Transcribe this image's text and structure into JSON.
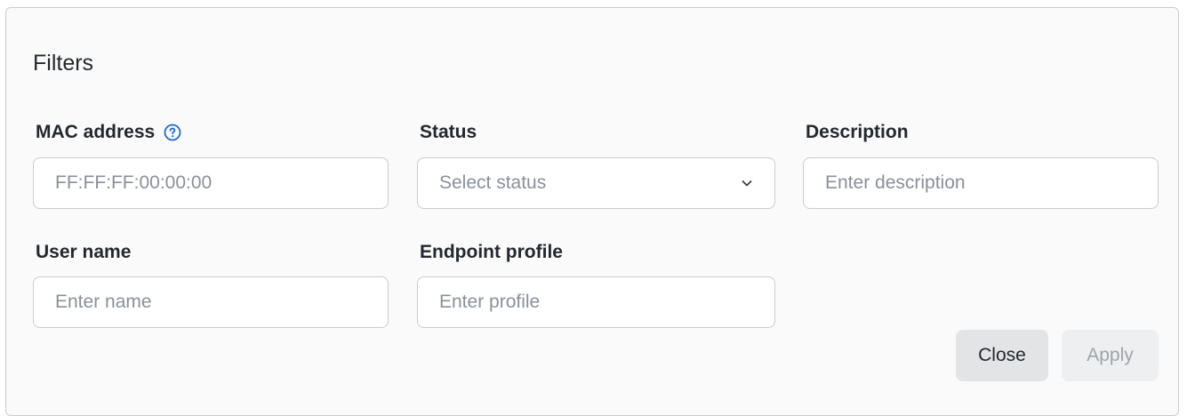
{
  "filters": {
    "title": "Filters",
    "mac_address": {
      "label": "MAC address",
      "placeholder": "FF:FF:FF:00:00:00",
      "help_icon": "question-circle-icon"
    },
    "status": {
      "label": "Status",
      "placeholder": "Select status",
      "icon": "chevron-down-icon"
    },
    "description": {
      "label": "Description",
      "placeholder": "Enter description"
    },
    "user_name": {
      "label": "User name",
      "placeholder": "Enter name"
    },
    "endpoint_profile": {
      "label": "Endpoint profile",
      "placeholder": "Enter profile"
    },
    "actions": {
      "close_label": "Close",
      "apply_label": "Apply"
    }
  },
  "colors": {
    "accent": "#1d69cc",
    "text": "#23282e",
    "placeholder": "#8a9099",
    "border": "#c9ccd1",
    "panel_bg": "#fafafa"
  }
}
